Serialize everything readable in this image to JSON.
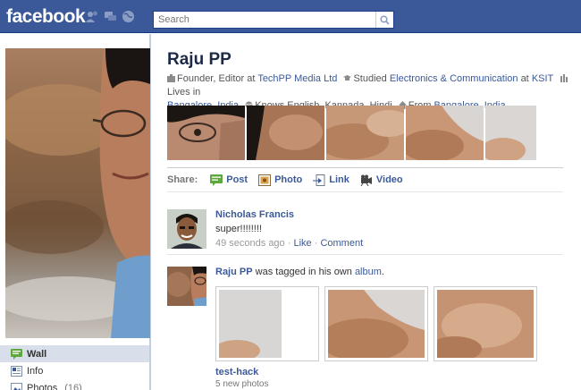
{
  "topbar": {
    "logo": "facebook",
    "search_placeholder": "Search",
    "icons": [
      "friends-icon",
      "messages-icon",
      "notifications-globe-icon"
    ],
    "bg_color": "#3b5998"
  },
  "profile": {
    "name": "Raju PP",
    "info": {
      "work_prefix": "Founder, Editor at",
      "work_link": "TechPP Media Ltd",
      "study_prefix": "Studied",
      "study_link": "Electronics & Communication",
      "study_at": "at",
      "school_link": "KSIT",
      "lives_prefix": "Lives in",
      "lives_link": "Bangalore, India",
      "knows": "Knows English, Kannada, Hindi",
      "from_prefix": "From",
      "from_link": "Bangalore, India"
    }
  },
  "leftnav": {
    "items": [
      {
        "label": "Wall",
        "count": "",
        "icon": "wall-icon",
        "active": true
      },
      {
        "label": "Info",
        "count": "",
        "icon": "info-icon",
        "active": false
      },
      {
        "label": "Photos",
        "count": "(16)",
        "icon": "photos-icon",
        "active": false
      }
    ]
  },
  "share": {
    "label": "Share:",
    "items": [
      {
        "label": "Post",
        "icon": "post-icon"
      },
      {
        "label": "Photo",
        "icon": "photo-icon"
      },
      {
        "label": "Link",
        "icon": "link-icon"
      },
      {
        "label": "Video",
        "icon": "video-icon"
      }
    ]
  },
  "feed": [
    {
      "actor": "Nicholas Francis",
      "message": "super!!!!!!!!",
      "time": "49 seconds ago",
      "dot1": "·",
      "like": "Like",
      "dot2": "·",
      "comment": "Comment"
    },
    {
      "actor": "Raju PP",
      "text": "was tagged in his own",
      "link": "album",
      "period": ".",
      "album_title": "test-hack",
      "album_sub": "5 new photos"
    }
  ]
}
